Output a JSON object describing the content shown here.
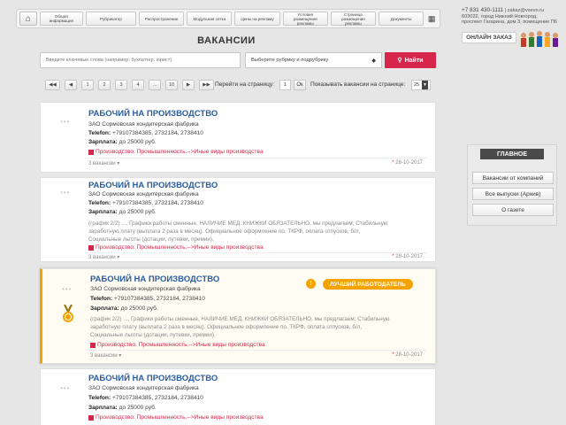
{
  "nav": {
    "items": [
      "Общая информация",
      "Рубрикатор",
      "Распространение",
      "Модульная сетка",
      "Цены на рекламу",
      "Условия размещения рекламы",
      "Страница размещения рекламы",
      "Документы"
    ]
  },
  "contact": {
    "phone": "+7 831 430-1111",
    "email": "zakaz@vsevn.ru",
    "address1": "603022, город Нижний Новгород,",
    "address2": "проспект Гагарина, дом 3, помещение П6"
  },
  "order_button": "ОНЛАЙН ЗАКАЗ",
  "page_title": "ВАКАНСИИ",
  "search": {
    "placeholder": "Введите ключевые слова (например: бухгалтер, юрист)",
    "category_label": "Выберите рубрику и подрубрику",
    "find_label": "Найти"
  },
  "pagination": {
    "pages": [
      "1",
      "2",
      "3",
      "4",
      "...",
      "10"
    ],
    "goto_label": "Перейти на страницу:",
    "goto_value": "1",
    "ok_label": "Ок",
    "per_page_label": "Показывать вакансии на странице:",
    "per_page_value": "25"
  },
  "jobs": [
    {
      "title": "РАБОЧИЙ НА ПРОИЗВОДСТВО",
      "company": "ЗАО Сормовская кондитерская фабрика",
      "phone_label": "Telefon:",
      "phone": "+79107384385, 2732184, 2738410",
      "salary_label": "Зарплата:",
      "salary": "до 25000 руб.",
      "category": "Производство. Промышленность.-->Иные виды производства",
      "vacancies": "3 вакансии",
      "date": "28-10-2017"
    },
    {
      "title": "РАБОЧИЙ НА ПРОИЗВОДСТВО",
      "company": "ЗАО Сормовская кондитерская фабрика",
      "phone_label": "Telefon:",
      "phone": "+79107384385, 2732184, 2738410",
      "salary_label": "Зарплата:",
      "salary": "до 25000 руб.",
      "desc1": "(график 2/2) ..., Графики работы сменные, НАЛИЧИЕ МЕД. КНИЖКИ ОБЯЗАТЕЛЬНО, мы предлагаем; Стабильную",
      "desc2": "заработную плату (выплата 2 раза в месяц). Официальное оформление по. ТКРФ, оплата отпусков, б/л,",
      "desc3": "Социальные льготы (дотации, путевки, премии).",
      "category": "Производство. Промышленность.-->Иные виды производства",
      "vacancies": "3 вакансии",
      "date": "28-10-2017"
    },
    {
      "title": "РАБОЧИЙ НА ПРОИЗВОДСТВО",
      "company": "ЗАО Сормовская кондитерская фабрика",
      "phone_label": "Telefon:",
      "phone": "+79107384385, 2732184, 2738410",
      "salary_label": "Зарплата:",
      "salary": "до 25000 руб.",
      "desc1": "(график 2/2) ..., Графики работы сменные, НАЛИЧИЕ МЕД. КНИЖКИ ОБЯЗАТЕЛЬНО, мы предлагаем; Стабильную",
      "desc2": "заработную плату (выплата 2 раза в месяц). Официальное оформление по. ТКРФ, оплата отпусков, б/л,",
      "desc3": "Социальные льготы (дотации, путевки, премии).",
      "category": "Производство. Промышленность.-->Иные виды производства",
      "vacancies": "3 вакансии",
      "date": "28-10-2017",
      "badge": "ЛУЧШИЙ РАБОТОДАТЕЛЬ"
    },
    {
      "title": "РАБОЧИЙ НА ПРОИЗВОДСТВО",
      "company": "ЗАО Сормовская кондитерская фабрика",
      "phone_label": "Telefon:",
      "phone": "+79107384385, 2732184, 2738410",
      "salary_label": "Зарплата:",
      "salary": "до 25000 руб.",
      "category": "Производство. Промышленность.-->Иные виды производства"
    }
  ],
  "sidebar": {
    "header": "ГЛАВНОЕ",
    "items": [
      "Вакансии от компаний",
      "Все выпуски (Архив)",
      "О газете"
    ]
  },
  "colors": {
    "accent": "#d7264b",
    "title_blue": "#2a5d9f",
    "badge_orange": "#f5a300"
  }
}
